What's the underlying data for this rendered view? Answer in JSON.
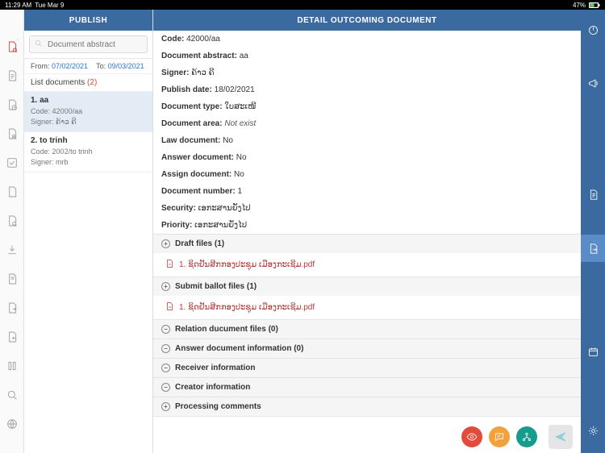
{
  "status_bar": {
    "time": "11:29 AM",
    "date": "Tue Mar 9",
    "battery": "47%"
  },
  "list_panel": {
    "title": "PUBLISH",
    "search_placeholder": "Document abstract",
    "from_label": "From:",
    "from_value": "07/02/2021",
    "to_label": "To:",
    "to_value": "09/03/2021",
    "count_label": "List documents",
    "count_value": "(2)",
    "items": [
      {
        "title": "1. aa",
        "code_label": "Code:",
        "code": "42000/aa",
        "signer_label": "Signer:",
        "signer": "ຄ້າວ ຄີ"
      },
      {
        "title": "2. to trinh",
        "code_label": "Code:",
        "code": "2002/to trinh",
        "signer_label": "Signer:",
        "signer": "mrb"
      }
    ]
  },
  "detail_panel": {
    "title": "DETAIL OUTCOMING DOCUMENT",
    "fields": {
      "code_label": "Code:",
      "code": "42000/aa",
      "abstract_label": "Document abstract:",
      "abstract": "aa",
      "signer_label": "Signer:",
      "signer": "ຄ້າວ ຄີ",
      "publish_label": "Publish date:",
      "publish": "18/02/2021",
      "type_label": "Document type:",
      "type": "ໃບສະເໜີ",
      "area_label": "Document area:",
      "area": "Not exist",
      "law_label": "Law document:",
      "law": "No",
      "answer_label": "Answer document:",
      "answer": "No",
      "assign_label": "Assign document:",
      "assign": "No",
      "number_label": "Document number:",
      "number": "1",
      "security_label": "Security:",
      "security": "ເອກະສານຍັ່ງໄປ",
      "priority_label": "Priority:",
      "priority": "ເອກະສານຍັ່ງໄປ"
    },
    "sections": {
      "draft": "Draft files (1)",
      "draft_file": "1. ຊິດຢັນສີກກອງປະຊຸມ ເມືອງກະເຊີມ.pdf",
      "ballot": "Submit ballot files (1)",
      "ballot_file": "1. ຊິດຢັນສີກກອງປະຊຸມ ເມືອງກະເຊີມ.pdf",
      "relation": "Relation ducument files (0)",
      "answerinfo": "Answer document information (0)",
      "receiver": "Receiver information",
      "creator": "Creator information",
      "processing": "Processing comments"
    }
  }
}
